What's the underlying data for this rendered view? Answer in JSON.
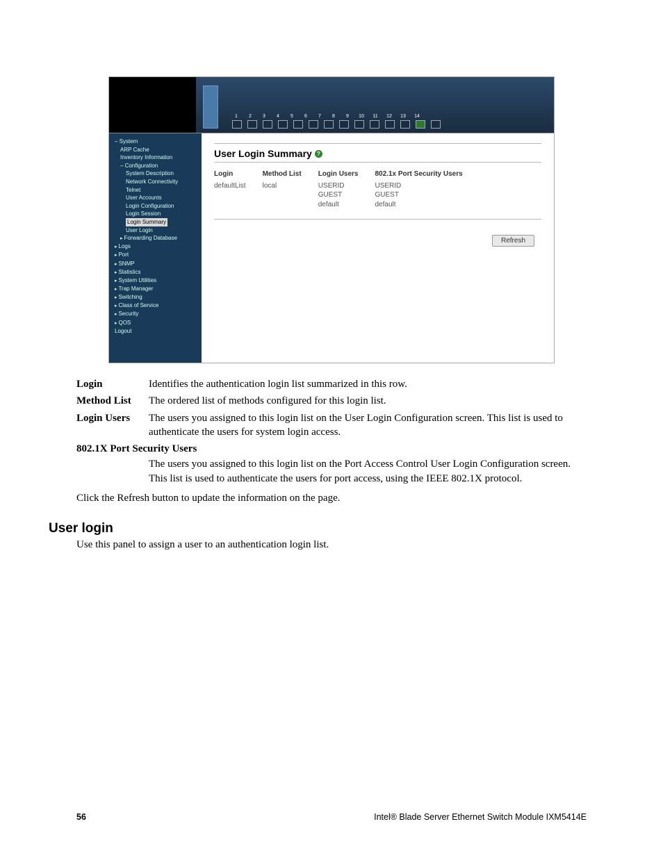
{
  "screenshot": {
    "ports": [
      "1",
      "2",
      "3",
      "4",
      "5",
      "6",
      "7",
      "8",
      "9",
      "10",
      "11",
      "12",
      "13",
      "14"
    ],
    "active_port_index": 12,
    "nav": {
      "system": "System",
      "arp": "ARP Cache",
      "inv": "Inventory Information",
      "config": "Configuration",
      "sysdesc": "System Description",
      "netconn": "Network Connectivity",
      "telnet": "Telnet",
      "useracct": "User Accounts",
      "logincfg": "Login Configuration",
      "loginsess": "Login Session",
      "loginsum": "Login Summary",
      "userlogin": "User Login",
      "fwddb": "Forwarding Database",
      "logs": "Logs",
      "port": "Port",
      "snmp": "SNMP",
      "stats": "Statistics",
      "sysutil": "System Utilities",
      "trapmgr": "Trap Manager",
      "switching": "Switching",
      "cos": "Class of Service",
      "security": "Security",
      "qos": "QOS",
      "logout": "Logout"
    },
    "content": {
      "title": "User Login Summary",
      "help_tooltip": "?",
      "columns": {
        "login": "Login",
        "method": "Method List",
        "users": "Login Users",
        "portsec": "802.1x Port Security Users"
      },
      "row": {
        "login": "defaultList",
        "method": "local",
        "users": [
          "USERID",
          "GUEST",
          "default"
        ],
        "portsec": [
          "USERID",
          "GUEST",
          "default"
        ]
      },
      "refresh": "Refresh"
    }
  },
  "defs": {
    "login_term": "Login",
    "login_body": "Identifies the authentication login list summarized in this row.",
    "method_term": "Method List",
    "method_body": "The ordered list of methods configured for this login list.",
    "users_term": "Login Users",
    "users_body": "The users you assigned to this login list on the User Login Configuration screen. This list is used to authenticate the users for system login access.",
    "portsec_term": "802.1X Port Security Users",
    "portsec_body": "The users you assigned to this login list on the Port Access Control User Login Configuration screen. This list is used to authenticate the users for port access, using the IEEE 802.1X protocol."
  },
  "refresh_note": "Click the Refresh button to update the information on the page.",
  "section": {
    "title": "User login",
    "body": "Use this panel to assign a user to an authentication login list."
  },
  "footer": {
    "page": "56",
    "product": "Intel® Blade Server Ethernet Switch Module IXM5414E"
  }
}
